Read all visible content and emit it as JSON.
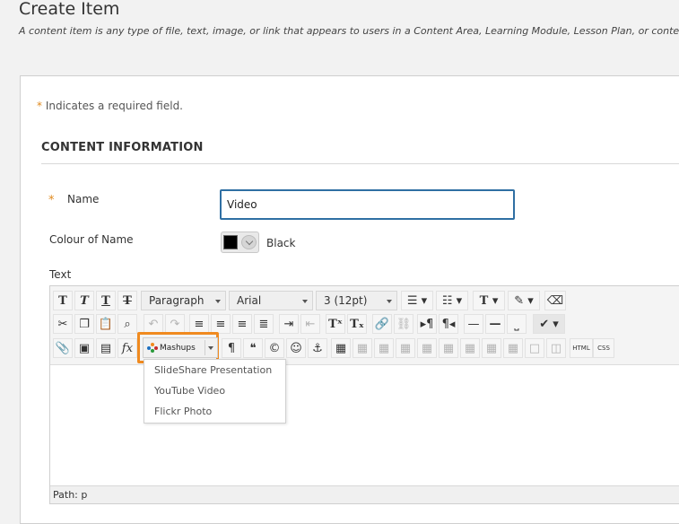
{
  "page": {
    "title": "Create Item",
    "description": "A content item is any type of file, text, image, or link that appears to users in a Content Area, Learning Module, Lesson Plan, or conte"
  },
  "form": {
    "required_star": "*",
    "required_note": "Indicates a required field.",
    "section_title": "CONTENT INFORMATION",
    "name_label": "Name",
    "name_value": "Video",
    "colour_label": "Colour of Name",
    "colour_value": "Black",
    "colour_hex": "#000000",
    "text_label": "Text"
  },
  "editor": {
    "paragraph_select": "Paragraph",
    "font_select": "Arial",
    "size_select": "3 (12pt)",
    "mashups_label": "Mashups",
    "html_label": "HTML",
    "css_label": "CSS",
    "mashups_menu": [
      "SlideShare Presentation",
      "YouTube Video",
      "Flickr Photo"
    ],
    "path_text": "Path: p"
  },
  "colors": {
    "accent_orange": "#f08a1f",
    "input_border": "#2f6fa3",
    "required_star": "#e08a1e"
  }
}
